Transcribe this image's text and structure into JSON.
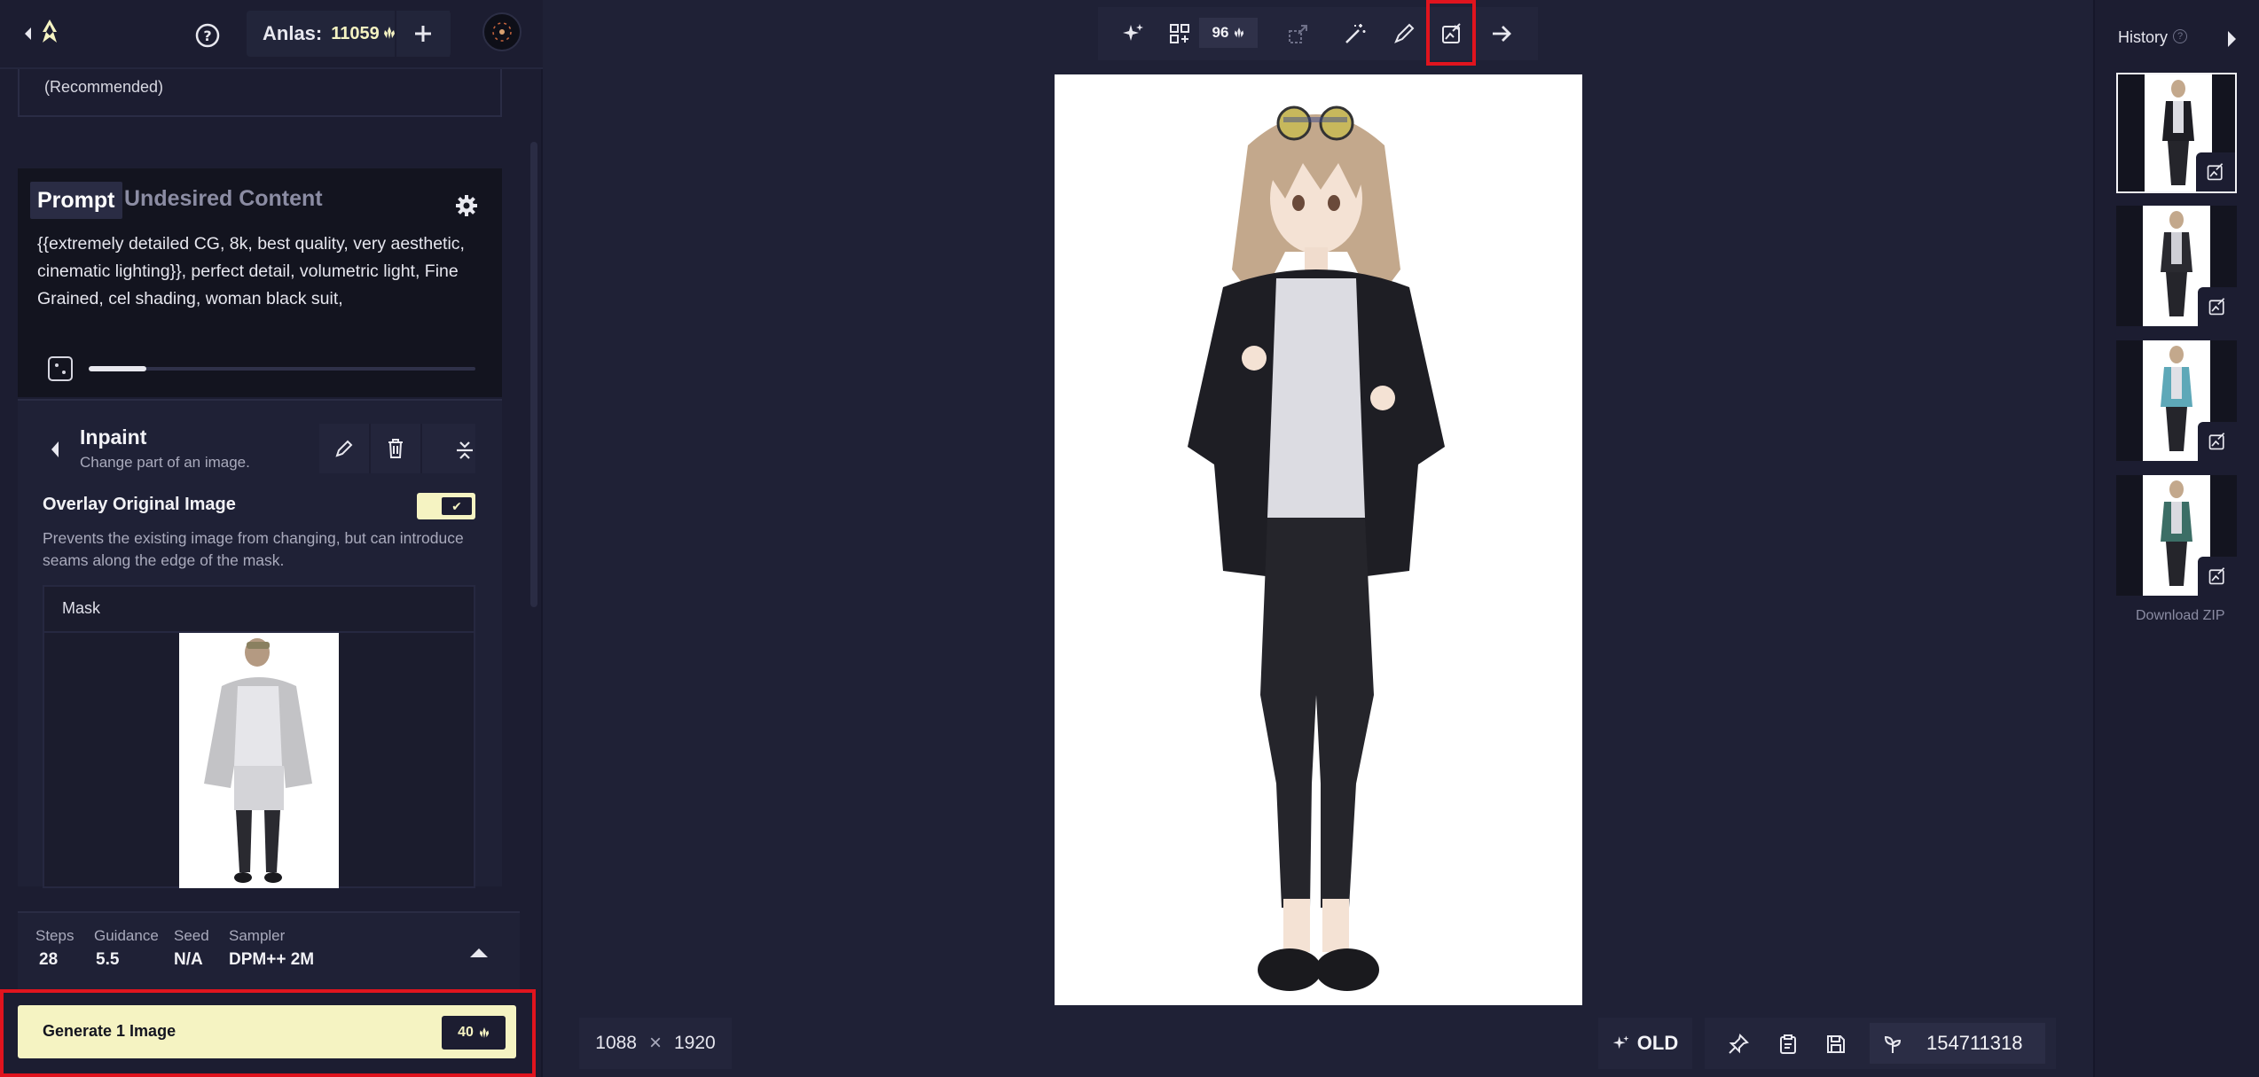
{
  "header": {
    "anlas_label": "Anlas:",
    "anlas_value": "11059"
  },
  "model": {
    "recommended_text": "(Recommended)"
  },
  "prompt": {
    "tabs": [
      "Prompt",
      "Undesired Content"
    ],
    "text": "{{extremely detailed CG, 8k, best quality, very aesthetic, cinematic lighting}}, perfect detail, volumetric light, Fine Grained, cel shading, woman black suit,",
    "strength_fraction": 0.15
  },
  "inpaint": {
    "title": "Inpaint",
    "description": "Change part of an image.",
    "overlay_label": "Overlay Original Image",
    "overlay_enabled": true,
    "overlay_description": "Prevents the existing image from changing, but can introduce seams along the edge of the mask.",
    "mask_label": "Mask"
  },
  "settings": {
    "steps_label": "Steps",
    "steps_value": "28",
    "guidance_label": "Guidance",
    "guidance_value": "5.5",
    "seed_label": "Seed",
    "seed_value": "N/A",
    "sampler_label": "Sampler",
    "sampler_value": "DPM++ 2M"
  },
  "generate": {
    "label": "Generate 1 Image",
    "cost": "40"
  },
  "toolbar": {
    "count": "96"
  },
  "image": {
    "width": "1088",
    "height": "1920",
    "times_symbol": "×"
  },
  "bottom": {
    "old_label": "OLD",
    "seed_value": "154711318"
  },
  "history": {
    "title": "History",
    "help_glyph": "?",
    "download_label": "Download ZIP"
  },
  "colors": {
    "accent": "#f5f3c2",
    "background": "#1f2136",
    "panel": "#1c1d31",
    "highlight_red": "#e0141e"
  },
  "icons": [
    "chevron-left-icon",
    "logo-icon",
    "help-icon",
    "plus-icon",
    "avatar",
    "gear-icon",
    "dice-icon",
    "pencil-icon",
    "trash-icon",
    "collapse-icon",
    "sparkle-icon",
    "variations-icon",
    "upscale-icon",
    "magic-wand-icon",
    "paint-brush-icon",
    "inpaint-icon",
    "arrow-right-icon",
    "pin-icon",
    "clipboard-icon",
    "save-icon",
    "seed-icon"
  ]
}
